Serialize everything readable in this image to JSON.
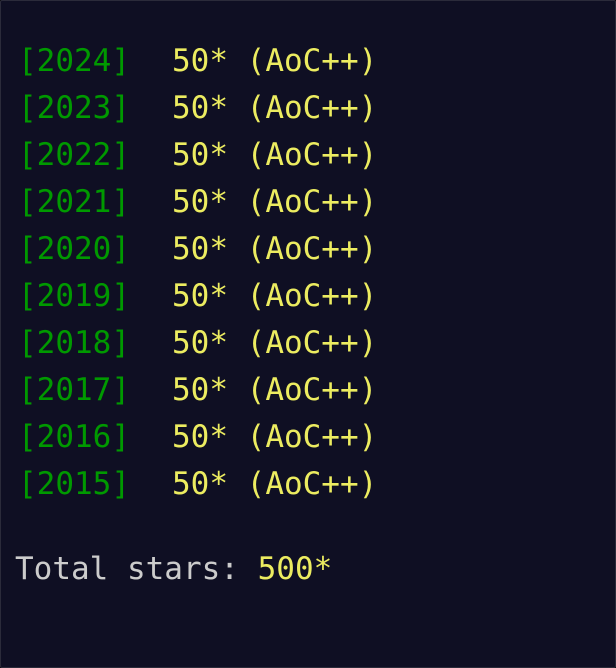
{
  "years": [
    {
      "year": "[2024]",
      "stars": "50* (AoC++)"
    },
    {
      "year": "[2023]",
      "stars": "50* (AoC++)"
    },
    {
      "year": "[2022]",
      "stars": "50* (AoC++)"
    },
    {
      "year": "[2021]",
      "stars": "50* (AoC++)"
    },
    {
      "year": "[2020]",
      "stars": "50* (AoC++)"
    },
    {
      "year": "[2019]",
      "stars": "50* (AoC++)"
    },
    {
      "year": "[2018]",
      "stars": "50* (AoC++)"
    },
    {
      "year": "[2017]",
      "stars": "50* (AoC++)"
    },
    {
      "year": "[2016]",
      "stars": "50* (AoC++)"
    },
    {
      "year": "[2015]",
      "stars": "50* (AoC++)"
    }
  ],
  "total": {
    "label": "Total stars: ",
    "value": "500*"
  },
  "colors": {
    "background": "#0f0f23",
    "year": "#009900",
    "stars": "#ffff66",
    "label": "#cccccc"
  }
}
